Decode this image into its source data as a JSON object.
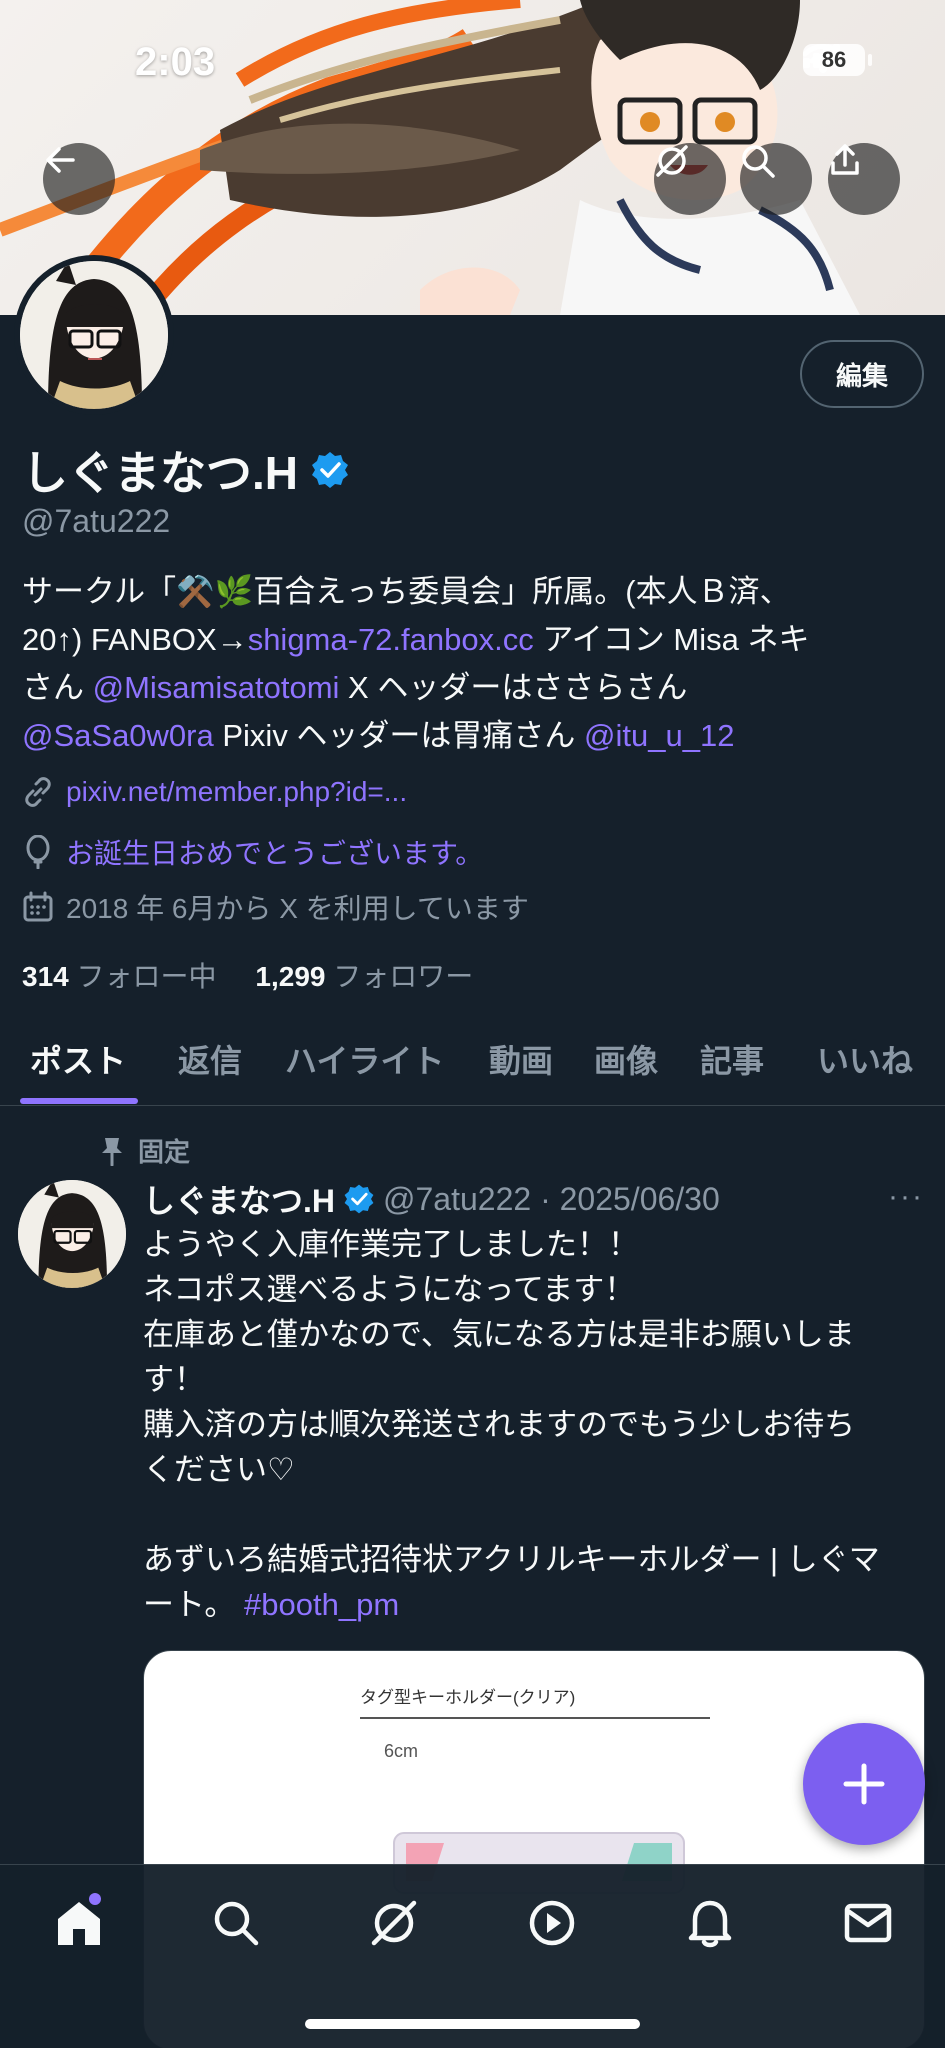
{
  "status_bar": {
    "time": "2:03",
    "battery": "86"
  },
  "profile": {
    "edit_label": "編集",
    "display_name": "しぐまなつ.H",
    "handle": "@7atu222",
    "bio": {
      "line1": "サークル「⚒️🌿百合えっち委員会」所属。(本人Ｂ済、",
      "line2_prefix": "20↑) FANBOX→",
      "fanbox_link": "shigma-72.fanbox.cc",
      "line2_suffix": " アイコン Misa ネキ",
      "line3_prefix": "さん ",
      "mention1": "@Misamisatotomi",
      "line3_suffix": " X ヘッダーはささらさん",
      "mention2": "@SaSa0w0ra",
      "line4_mid": " Pixiv ヘッダーは胃痛さん ",
      "mention3": "@itu_u_12"
    },
    "website": "pixiv.net/member.php?id=...",
    "birthday": "お誕生日おめでとうございます。",
    "joined": "2018 年 6月から X を利用しています",
    "following_count": "314",
    "following_label": "フォロー中",
    "followers_count": "1,299",
    "followers_label": "フォロワー"
  },
  "tabs": [
    "ポスト",
    "返信",
    "ハイライト",
    "動画",
    "画像",
    "記事",
    "いいね"
  ],
  "pinned_post": {
    "pinned_label": "固定",
    "author": "しぐまなつ.H",
    "handle_date": "@7atu222 · 2025/06/30",
    "more": "···",
    "text": "ようやく入庫作業完了しました！！\nネコポス選べるようになってます！\n在庫あと僅かなので、気になる方は是非お願いしま\nす！\n購入済の方は順次発送されますのでもう少しお待ち\nください♡\n\nあずいろ結婚式招待状アクリルキーホルダー | しぐマ\nート。",
    "hashtag": "#booth_pm",
    "media": {
      "title": "タグ型キーホルダー(クリア)",
      "dimension": "6cm"
    }
  },
  "colors": {
    "background": "#15202b",
    "accent": "#8f74ff",
    "verified": "#1d9bf0",
    "muted_text": "#8b98a5"
  }
}
